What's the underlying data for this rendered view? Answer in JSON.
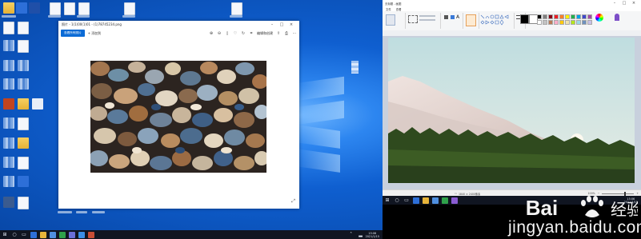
{
  "desktop": {
    "accent": "#0b58c8",
    "icons": [
      "folder-icon",
      "file-icon",
      "file-icon",
      "file-icon",
      "app-icon",
      "file-icon"
    ]
  },
  "photos_window": {
    "title": "照片 - 1(1)00(1)01 - (1)78745234.png",
    "toolbar": {
      "primary_label": "查看所有照片",
      "add_label": "添加到",
      "edit_label": "编辑和创建",
      "share_icon": "share-icon",
      "more_icon": "more-icon"
    },
    "image_description_icon": "photo-stones"
  },
  "taskbar_left": {
    "time": "15:06",
    "date": "2021/1/15"
  },
  "paint": {
    "title": "无标题 - 画图",
    "menu": [
      "文件",
      "查看"
    ],
    "ribbon_groups": [
      "剪贴板",
      "图像",
      "工具",
      "形状",
      "颜色"
    ],
    "status": {
      "size": "1840 × 2400像素",
      "zoom": "100%"
    },
    "palette": [
      "#000000",
      "#7f7f7f",
      "#880015",
      "#ed1c24",
      "#ff7f27",
      "#fff200",
      "#22b14c",
      "#00a2e8",
      "#3f48cc",
      "#a349a4",
      "#ffffff",
      "#c3c3c3",
      "#b97a57",
      "#ffaec9",
      "#ffc90e",
      "#efe4b0",
      "#b5e61d",
      "#99d9ea",
      "#7092be",
      "#c8bfe7"
    ],
    "color1": "#000000",
    "color2": "#ffffff"
  },
  "taskbar_right": {
    "time": "15:06",
    "date": "2021/1/15"
  },
  "watermark": {
    "brand": "Bai 经验",
    "url": "jingyan.baidu.com"
  }
}
